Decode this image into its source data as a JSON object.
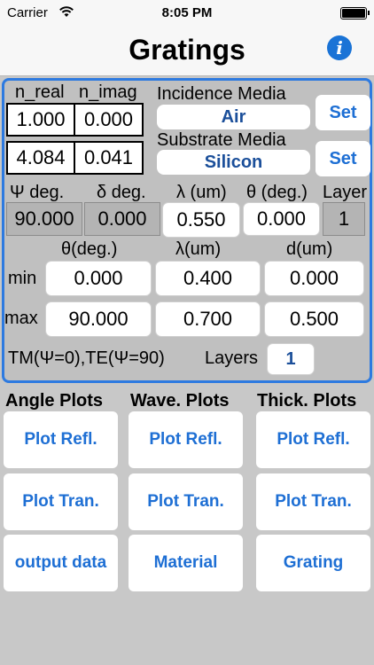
{
  "status": {
    "carrier": "Carrier",
    "time": "8:05 PM"
  },
  "nav": {
    "title": "Gratings",
    "info_glyph": "i"
  },
  "index": {
    "n_real_label": "n_real",
    "n_imag_label": "n_imag",
    "incidence": {
      "n_real": "1.000",
      "n_imag": "0.000"
    },
    "substrate": {
      "n_real": "4.084",
      "n_imag": "0.041"
    }
  },
  "media": {
    "incidence_label": "Incidence Media",
    "incidence_value": "Air",
    "substrate_label": "Substrate Media",
    "substrate_value": "Silicon",
    "set_label": "Set"
  },
  "params": {
    "psi_label": "Ψ deg.",
    "delta_label": "δ deg.",
    "lambda_label": "λ (um)",
    "theta_label": "θ (deg.)",
    "layer_label": "Layer",
    "psi_value": "90.000",
    "delta_value": "0.000",
    "lambda_value": "0.550",
    "theta_value": "0.000",
    "layer_value": "1"
  },
  "range": {
    "theta_header": "θ(deg.)",
    "lambda_header": "λ(um)",
    "d_header": "d(um)",
    "min_label": "min",
    "max_label": "max",
    "min": {
      "theta": "0.000",
      "lambda": "0.400",
      "d": "0.000"
    },
    "max": {
      "theta": "90.000",
      "lambda": "0.700",
      "d": "0.500"
    }
  },
  "polarization_note": "TM(Ψ=0),TE(Ψ=90)",
  "layers": {
    "label": "Layers",
    "value": "1"
  },
  "plots": {
    "angle_title": "Angle Plots",
    "wave_title": "Wave. Plots",
    "thick_title": "Thick. Plots",
    "plot_refl": "Plot Refl.",
    "plot_tran": "Plot Tran.",
    "output_data": "output data",
    "material": "Material",
    "grating": "Grating"
  }
}
